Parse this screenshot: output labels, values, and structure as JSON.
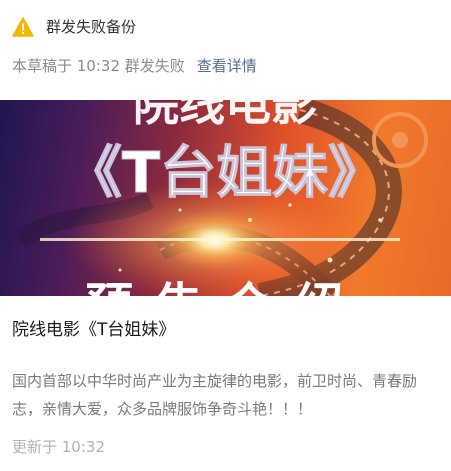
{
  "header": {
    "warning_title": "群发失败备份",
    "status_text": "本草稿于 10:32 群发失败",
    "details_link": "查看详情"
  },
  "banner": {
    "top_text": "院线电影",
    "main_text": "《T台姐妹》",
    "bottom_text": "预告介绍"
  },
  "article": {
    "title": "院线电影《T台姐妹》",
    "description": "国内首部以中华时尚产业为主旋律的电影，前卫时尚、青春励志，亲情大爱，众多品牌服饰争奇斗艳！！！",
    "updated": "更新于 10:32"
  },
  "colors": {
    "warning": "#f5b800",
    "link": "#576b95"
  }
}
